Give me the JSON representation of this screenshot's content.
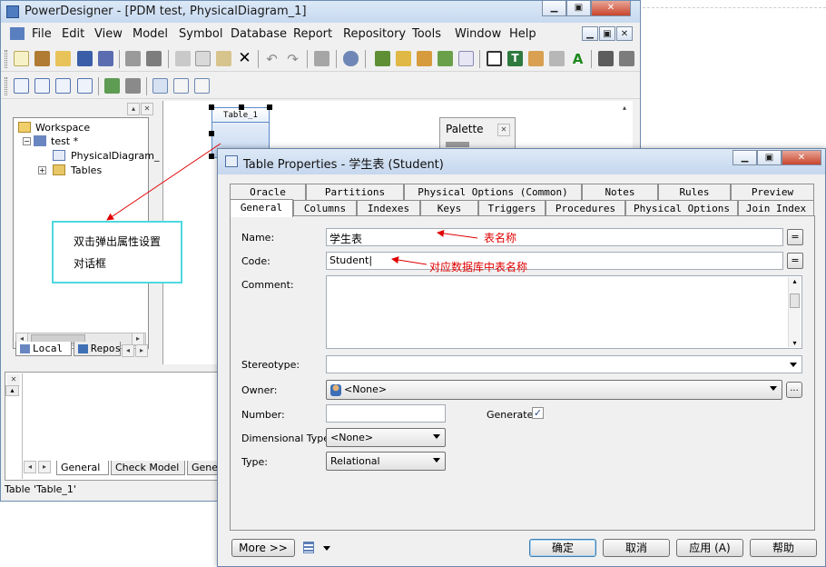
{
  "main_window": {
    "title": "PowerDesigner - [PDM test, PhysicalDiagram_1]",
    "menu": [
      "File",
      "Edit",
      "View",
      "Model",
      "Symbol",
      "Database",
      "Report",
      "Repository",
      "Tools",
      "Window",
      "Help"
    ]
  },
  "browser": {
    "tree": {
      "workspace": "Workspace",
      "model": "test *",
      "diagram": "PhysicalDiagram_",
      "tables": "Tables"
    },
    "tabs": [
      "Local",
      "Repos"
    ]
  },
  "diagram": {
    "table_label": "Table_1",
    "palette_title": "Palette"
  },
  "output": {
    "tabs": [
      "General",
      "Check Model",
      "Gene"
    ]
  },
  "status_text": "Table 'Table_1'",
  "annotation": {
    "line1": "双击弹出属性设置",
    "line2": "对话框"
  },
  "dialog": {
    "title": "Table Properties - 学生表 (Student)",
    "tabs_row1": [
      "Oracle",
      "Partitions",
      "Physical Options (Common)",
      "Notes",
      "Rules",
      "Preview"
    ],
    "tabs_row2": [
      "General",
      "Columns",
      "Indexes",
      "Keys",
      "Triggers",
      "Procedures",
      "Physical Options",
      "Join Index"
    ],
    "fields": {
      "name_label": "Name:",
      "name_value": "学生表",
      "code_label": "Code:",
      "code_value": "Student",
      "comment_label": "Comment:",
      "stereotype_label": "Stereotype:",
      "owner_label": "Owner:",
      "owner_value": "<None>",
      "number_label": "Number:",
      "generate_label": "Generate:",
      "dimensional_label": "Dimensional Type:",
      "dimensional_value": "<None>",
      "type_label": "Type:",
      "type_value": "Relational"
    },
    "notes": {
      "name_note": "表名称",
      "code_note": "对应数据库中表名称"
    },
    "buttons": {
      "more": "More >>",
      "ok": "确定",
      "cancel": "取消",
      "apply": "应用 (A)",
      "help": "帮助"
    }
  },
  "colors": {
    "annotation_border": "#4ed8e0",
    "note_red": "#e00000"
  }
}
